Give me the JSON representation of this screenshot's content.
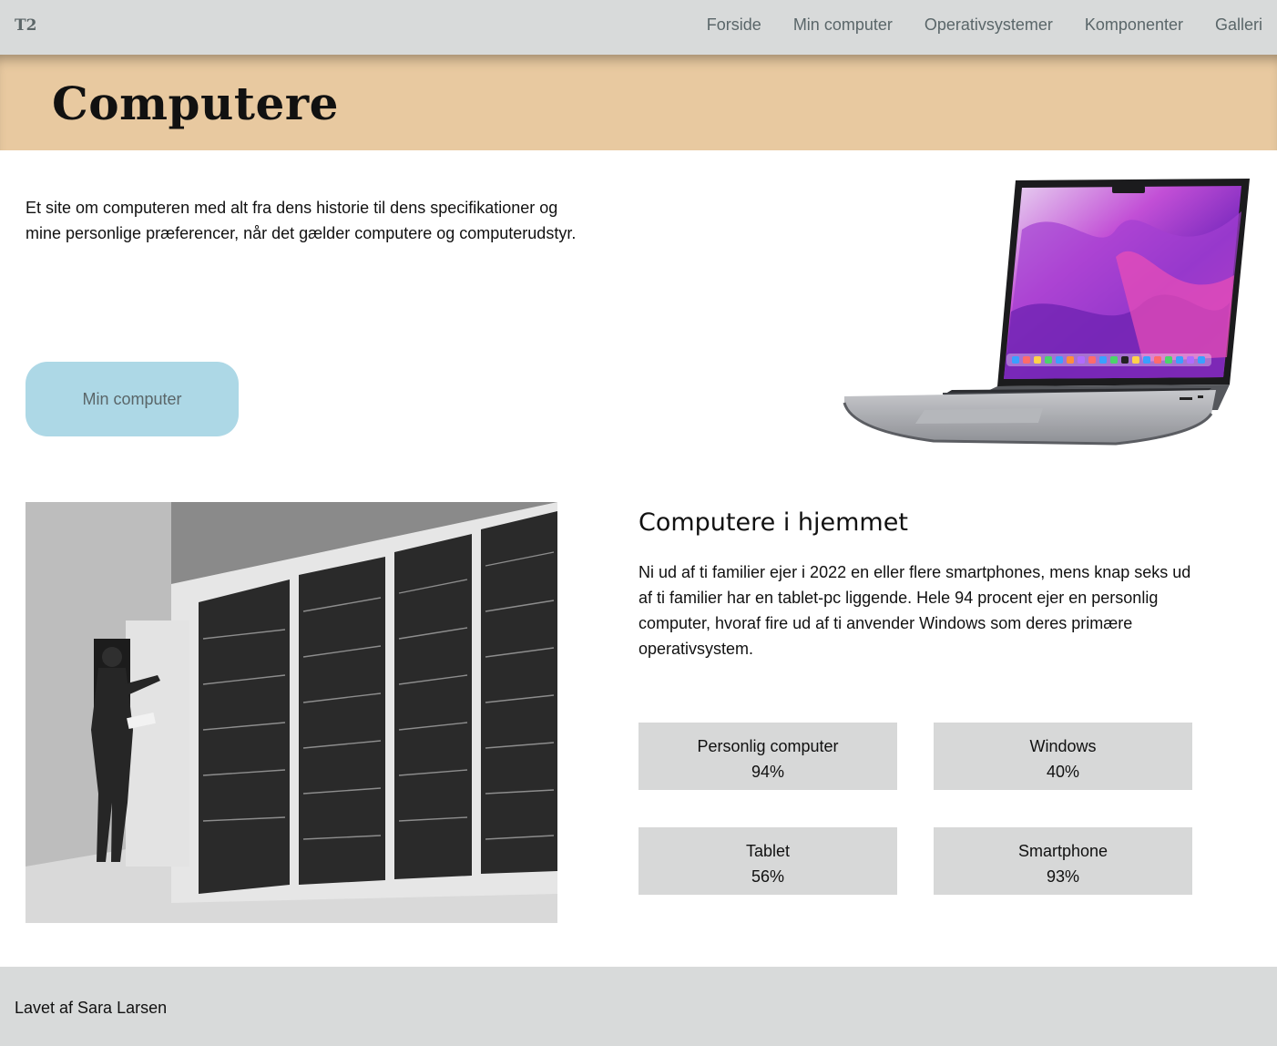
{
  "nav": {
    "brand": "T2",
    "links": [
      "Forside",
      "Min computer",
      "Operativsystemer",
      "Komponenter",
      "Galleri"
    ]
  },
  "hero": {
    "title": "Computere"
  },
  "intro": {
    "text": "Et site om computeren med alt fra dens historie til dens specifikationer og mine personlige præferencer, når det gælder computere og computerudstyr.",
    "button_label": "Min computer"
  },
  "home": {
    "title": "Computere i hjemmet",
    "body": "Ni ud af ti familier ejer i 2022 en eller flere smartphones, mens knap seks ud af ti familier har en tablet-pc liggende. Hele 94 procent ejer en personlig computer, hvoraf fire ud af ti anvender Windows som deres primære operativsystem.",
    "stats": [
      {
        "label": "Personlig computer",
        "value": "94%"
      },
      {
        "label": "Windows",
        "value": "40%"
      },
      {
        "label": "Tablet",
        "value": "56%"
      },
      {
        "label": "Smartphone",
        "value": "93%"
      }
    ]
  },
  "footer": {
    "text": "Lavet af Sara Larsen"
  },
  "colors": {
    "nav_bg": "#d8dada",
    "hero_bg": "#e8c9a0",
    "button_bg": "#add8e6",
    "stat_bg": "#d7d8d8"
  }
}
